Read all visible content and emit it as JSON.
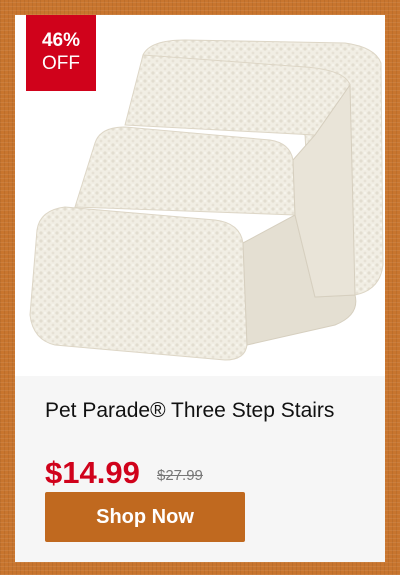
{
  "badge": {
    "percent": "46%",
    "label": "OFF"
  },
  "product": {
    "image_alt": "pet stairs image",
    "title": "Pet Parade® Three Step Stairs",
    "price": "$14.99",
    "original_price": "$27.99"
  },
  "cta": {
    "label": "Shop Now"
  },
  "colors": {
    "accent": "#d0021b",
    "button": "#c0691f",
    "border": "#c8752e"
  }
}
